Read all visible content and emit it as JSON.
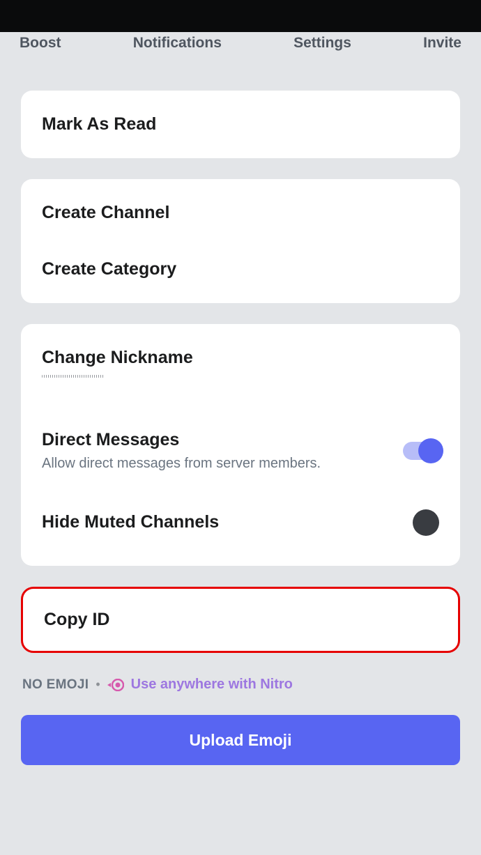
{
  "nav": {
    "boost": "Boost",
    "notifications": "Notifications",
    "settings": "Settings",
    "invite": "Invite"
  },
  "actions": {
    "mark_as_read": "Mark As Read",
    "create_channel": "Create Channel",
    "create_category": "Create Category",
    "change_nickname": "Change Nickname",
    "copy_id": "Copy ID"
  },
  "toggles": {
    "dm": {
      "title": "Direct Messages",
      "sub": "Allow direct messages from server members."
    },
    "hide_muted": {
      "title": "Hide Muted Channels"
    }
  },
  "footer": {
    "no_emoji": "NO EMOJI",
    "nitro_text": "Use anywhere with Nitro",
    "upload": "Upload Emoji"
  }
}
